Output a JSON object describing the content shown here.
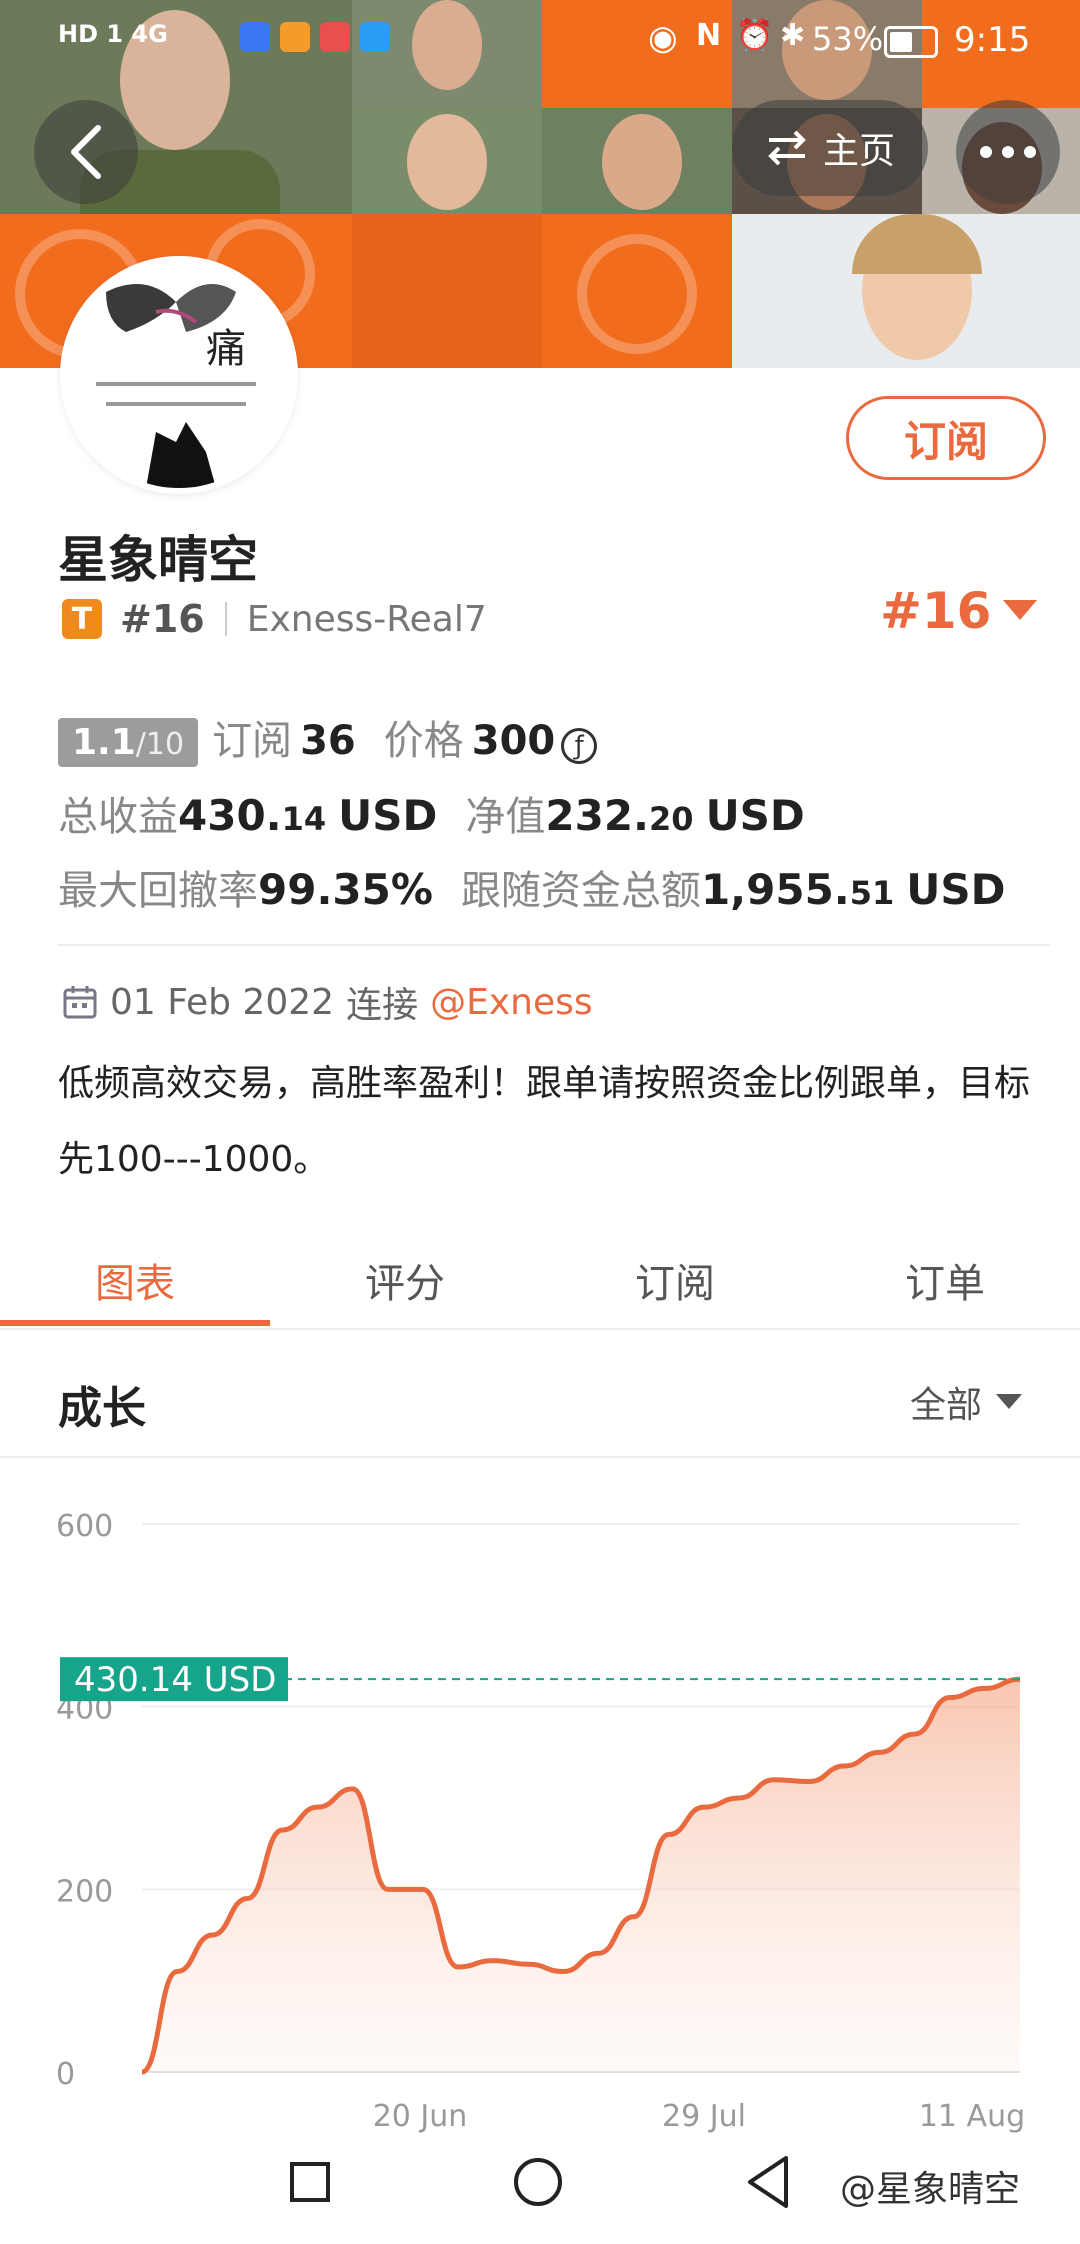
{
  "status_bar": {
    "network": "HD 1  4G",
    "battery": "53%",
    "time": "9:15"
  },
  "header": {
    "home_label": "主页",
    "back_icon": "chevron-left-icon",
    "more_icon": "more-dots-icon"
  },
  "profile": {
    "subscribe_label": "订阅",
    "name": "星象晴空",
    "badge_letter": "T",
    "rank": "#16",
    "account": "Exness-Real7",
    "rank_right": "#16"
  },
  "stats": {
    "score": "1.1",
    "score_max": "/10",
    "subscribe_label": "订阅",
    "subscribe_count": "36",
    "price_label": "价格",
    "price_value": "300",
    "price_icon": "ƒ",
    "total_profit_label": "总收益",
    "total_profit_int": "430.",
    "total_profit_dec": "14",
    "total_profit_unit": "USD",
    "net_value_label": "净值",
    "net_value_int": "232.",
    "net_value_dec": "20",
    "net_value_unit": "USD",
    "drawdown_label": "最大回撤率",
    "drawdown_value": "99.35%",
    "follow_label": "跟随资金总额",
    "follow_int": "1,955.",
    "follow_dec": "51",
    "follow_unit": "USD"
  },
  "join": {
    "date": "01 Feb 2022",
    "connect_label": "连接",
    "broker": "@Exness"
  },
  "description": "低频高效交易，高胜率盈利！跟单请按照资金比例跟单，目标先100---1000。",
  "tabs": [
    {
      "label": "图表",
      "active": true
    },
    {
      "label": "评分",
      "active": false
    },
    {
      "label": "订阅",
      "active": false
    },
    {
      "label": "订单",
      "active": false
    }
  ],
  "growth": {
    "title": "成长",
    "filter_label": "全部"
  },
  "chart_data": {
    "type": "area",
    "y_ticks": [
      "600",
      "400",
      "200",
      "0"
    ],
    "ylim": [
      0,
      600
    ],
    "x_ticks": [
      "20 Jun",
      "29 Jul",
      "11 Aug"
    ],
    "current_label": "430.14 USD",
    "current_value": 430.14,
    "line_color": "#ea6a3f",
    "marker_color": "#16a58a",
    "values": [
      0,
      110,
      150,
      190,
      265,
      290,
      310,
      200,
      200,
      115,
      122,
      118,
      110,
      130,
      170,
      260,
      290,
      300,
      320,
      318,
      335,
      350,
      370,
      410,
      420,
      430
    ]
  },
  "watermark": "@星象晴空"
}
